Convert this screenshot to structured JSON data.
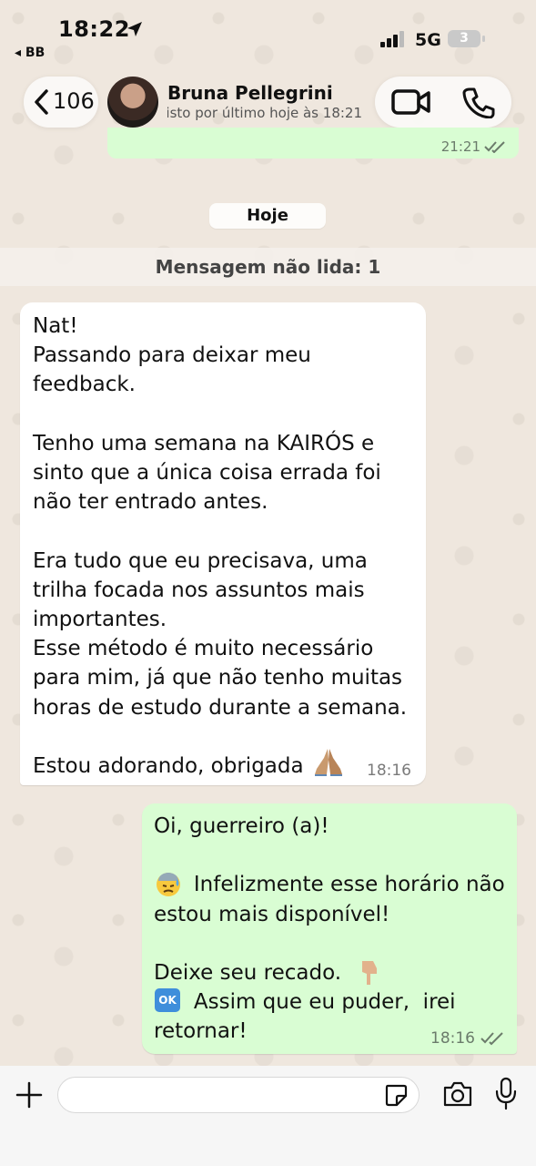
{
  "status_bar": {
    "time": "18:22",
    "back_app": "◂ BB",
    "network": "5G",
    "battery": "3"
  },
  "header": {
    "back_count": "106",
    "contact_name": "Bruna Pellegrini",
    "last_seen": "visto por último hoje às 18:21"
  },
  "previous_message": {
    "time": "21:21"
  },
  "chat": {
    "date_chip": "Hoje",
    "unread_banner": "Mensagem não lida: 1"
  },
  "messages": [
    {
      "direction": "incoming",
      "text": "Nat!\nPassando para deixar meu feedback.\n\nTenho uma semana na KAIRÓS e sinto que a única coisa errada foi não ter entrado antes.\n\nEra tudo que eu precisava, uma trilha focada nos assuntos mais importantes.\nEsse método é muito necessário para mim, já que não tenho muitas horas de estudo durante a semana.\n\nEstou adorando, obrigada",
      "emoji_icon": "praying-hands-icon",
      "time": "18:16"
    },
    {
      "direction": "outgoing",
      "text": "Oi, guerreiro (a)!\n\n      Infelizmente esse horário não estou mais disponível!\n\nDeixe seu recado.\n      Assim que eu puder,  irei retornar!",
      "emoji_icons": [
        "sweat-face-icon",
        "pointing-down-icon",
        "ok-icon"
      ],
      "ok_label": "OK",
      "time": "18:16",
      "status": "read"
    }
  ],
  "input": {
    "placeholder": ""
  },
  "colors": {
    "wallpaper": "#efe7de",
    "outgoing_bubble": "#d9fdd3",
    "incoming_bubble": "#ffffff",
    "read_ticks": "#6b7b6b"
  }
}
